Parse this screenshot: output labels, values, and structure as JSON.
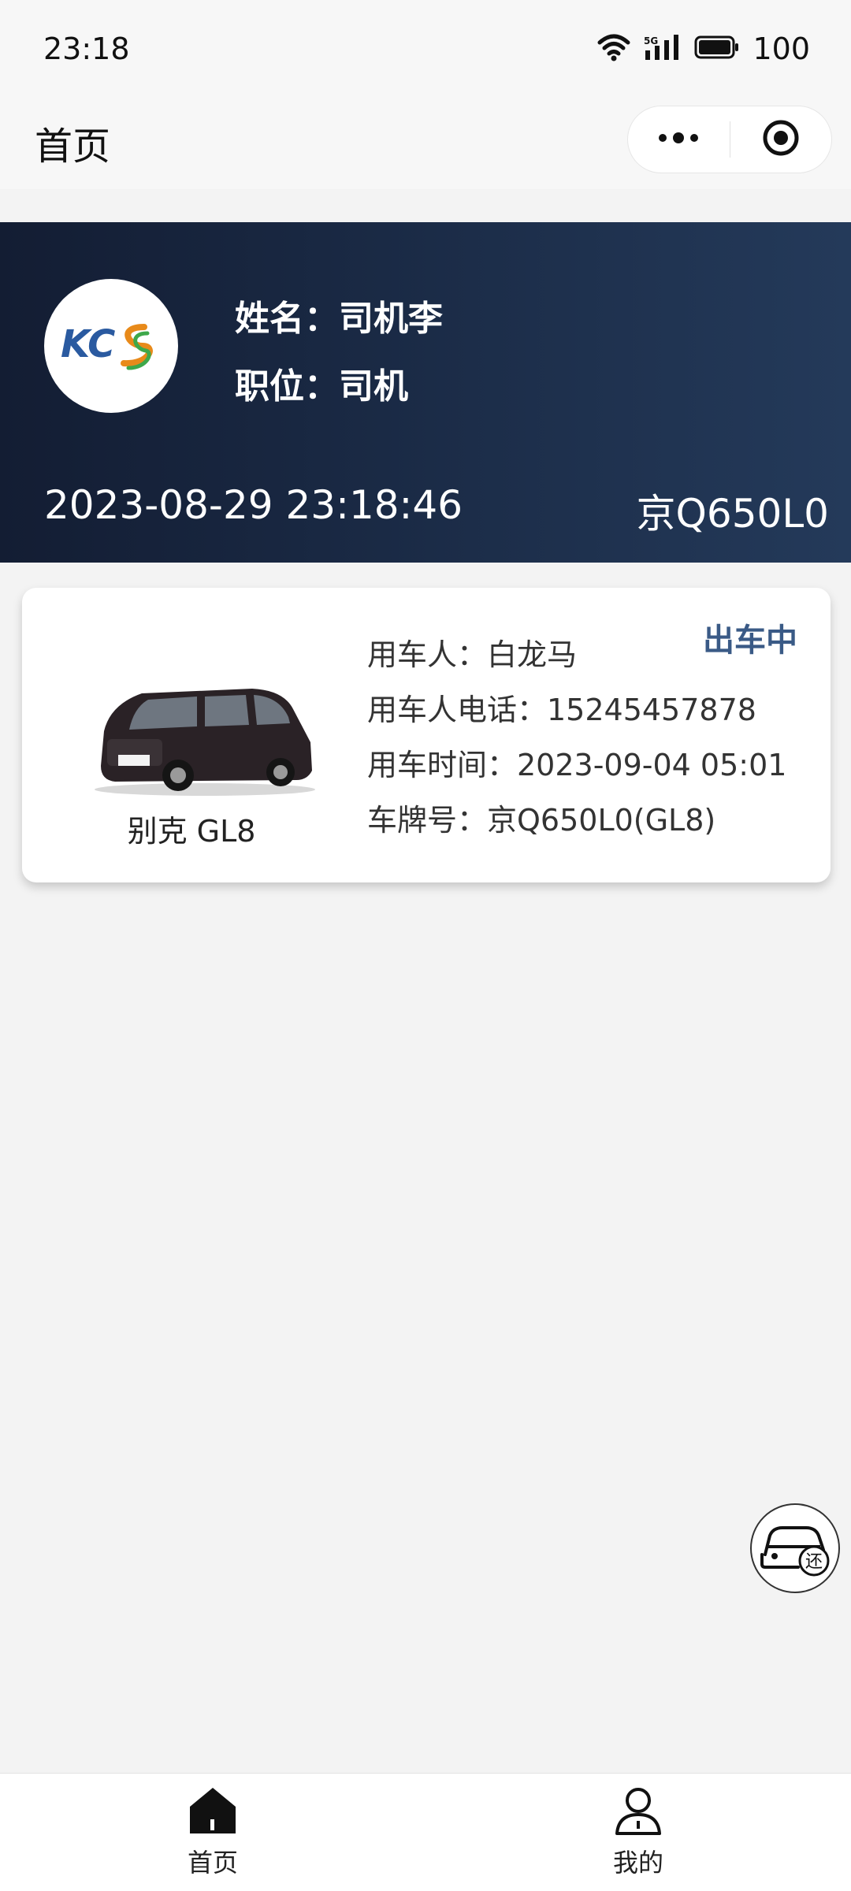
{
  "status_bar": {
    "time": "23:18",
    "network": "5G",
    "battery": "100",
    "icons": [
      "wifi-icon",
      "signal-icon",
      "battery-icon"
    ]
  },
  "nav": {
    "title": "首页",
    "capsule_icons": [
      "more-icon",
      "target-icon"
    ]
  },
  "profile": {
    "avatar_logo_text": "KCS",
    "name_line": "姓名：司机李",
    "position_line": "职位：司机",
    "datetime": "2023-08-29 23:18:46",
    "plate": "京Q650L0"
  },
  "card": {
    "status": "出车中",
    "car_name": "别克 GL8",
    "user_line": "用车人：白龙马",
    "phone_line": "用车人电话：15245457878",
    "time_line": "用车时间：2023-09-04 05:01",
    "plate_line": "车牌号：京Q650L0(GL8)"
  },
  "float_button": {
    "icon": "return-car-icon",
    "text": "还"
  },
  "tabbar": {
    "items": [
      {
        "label": "首页",
        "icon": "home-icon",
        "active": true
      },
      {
        "label": "我的",
        "icon": "user-icon",
        "active": false
      }
    ]
  },
  "colors": {
    "banner_dark": "#131d33",
    "banner_light": "#243a5a",
    "status_accent": "#3a5a86",
    "page_bg": "#f3f3f3"
  }
}
